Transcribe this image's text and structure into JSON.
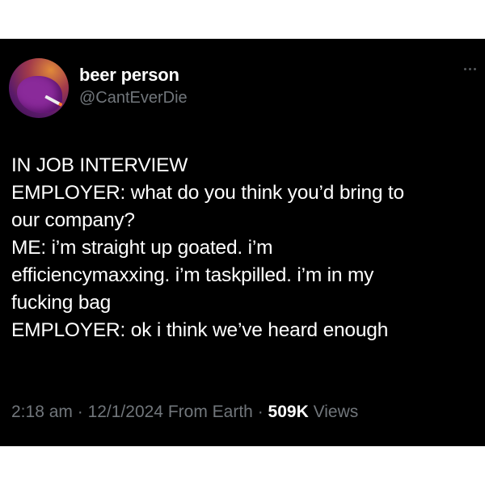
{
  "author": {
    "display_name": "beer person",
    "handle": "@CantEverDie"
  },
  "tweet": {
    "lines": [
      "IN JOB INTERVIEW",
      "EMPLOYER:  what do you think you’d bring to",
      "our company?",
      "ME:  i’m straight up goated.  i’m",
      "efficiencymaxxing.  i’m taskpilled.  i’m in my",
      "fucking bag",
      "EMPLOYER:  ok i think we’ve heard enough"
    ]
  },
  "meta": {
    "time": "2:18 am",
    "date": "12/1/2024",
    "source": "From Earth",
    "separator": " · ",
    "views_count": "509K",
    "views_label": "Views"
  },
  "icons": {
    "more": "more-dots-icon"
  },
  "colors": {
    "background": "#000000",
    "text": "#ffffff",
    "secondary": "#71767b"
  }
}
